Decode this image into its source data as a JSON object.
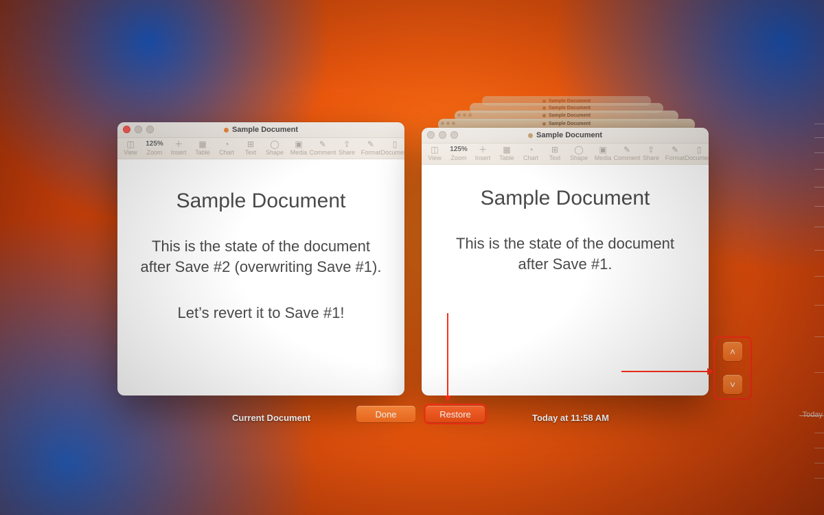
{
  "left_window": {
    "title": "Sample Document",
    "toolbar": {
      "view": "View",
      "zoom_value": "125%",
      "zoom_label": "Zoom",
      "insert": "Insert",
      "table": "Table",
      "chart": "Chart",
      "text": "Text",
      "shape": "Shape",
      "media": "Media",
      "comment": "Comment",
      "share": "Share",
      "format": "Format",
      "document": "Document"
    },
    "body": {
      "heading": "Sample Document",
      "para1": "This is the state of the document after Save #2 (overwriting Save #1).",
      "para2": "Let’s revert it to Save #1!"
    }
  },
  "right_window": {
    "title": "Sample Document",
    "toolbar": {
      "view": "View",
      "zoom_value": "125%",
      "zoom_label": "Zoom",
      "insert": "Insert",
      "table": "Table",
      "chart": "Chart",
      "text": "Text",
      "shape": "Shape",
      "media": "Media",
      "comment": "Comment",
      "share": "Share",
      "format": "Format",
      "document": "Document"
    },
    "body": {
      "heading": "Sample Document",
      "para1": "This is the state of the document after Save #1."
    }
  },
  "ghost_titles": {
    "g1": "Sample Document",
    "g2": "Sample Document",
    "g3": "Sample Document",
    "g4": "Sample Document"
  },
  "captions": {
    "left": "Current Document",
    "right": "Today at 11:58 AM"
  },
  "buttons": {
    "done": "Done",
    "restore": "Restore"
  },
  "timeline": {
    "now_label": "Today"
  }
}
